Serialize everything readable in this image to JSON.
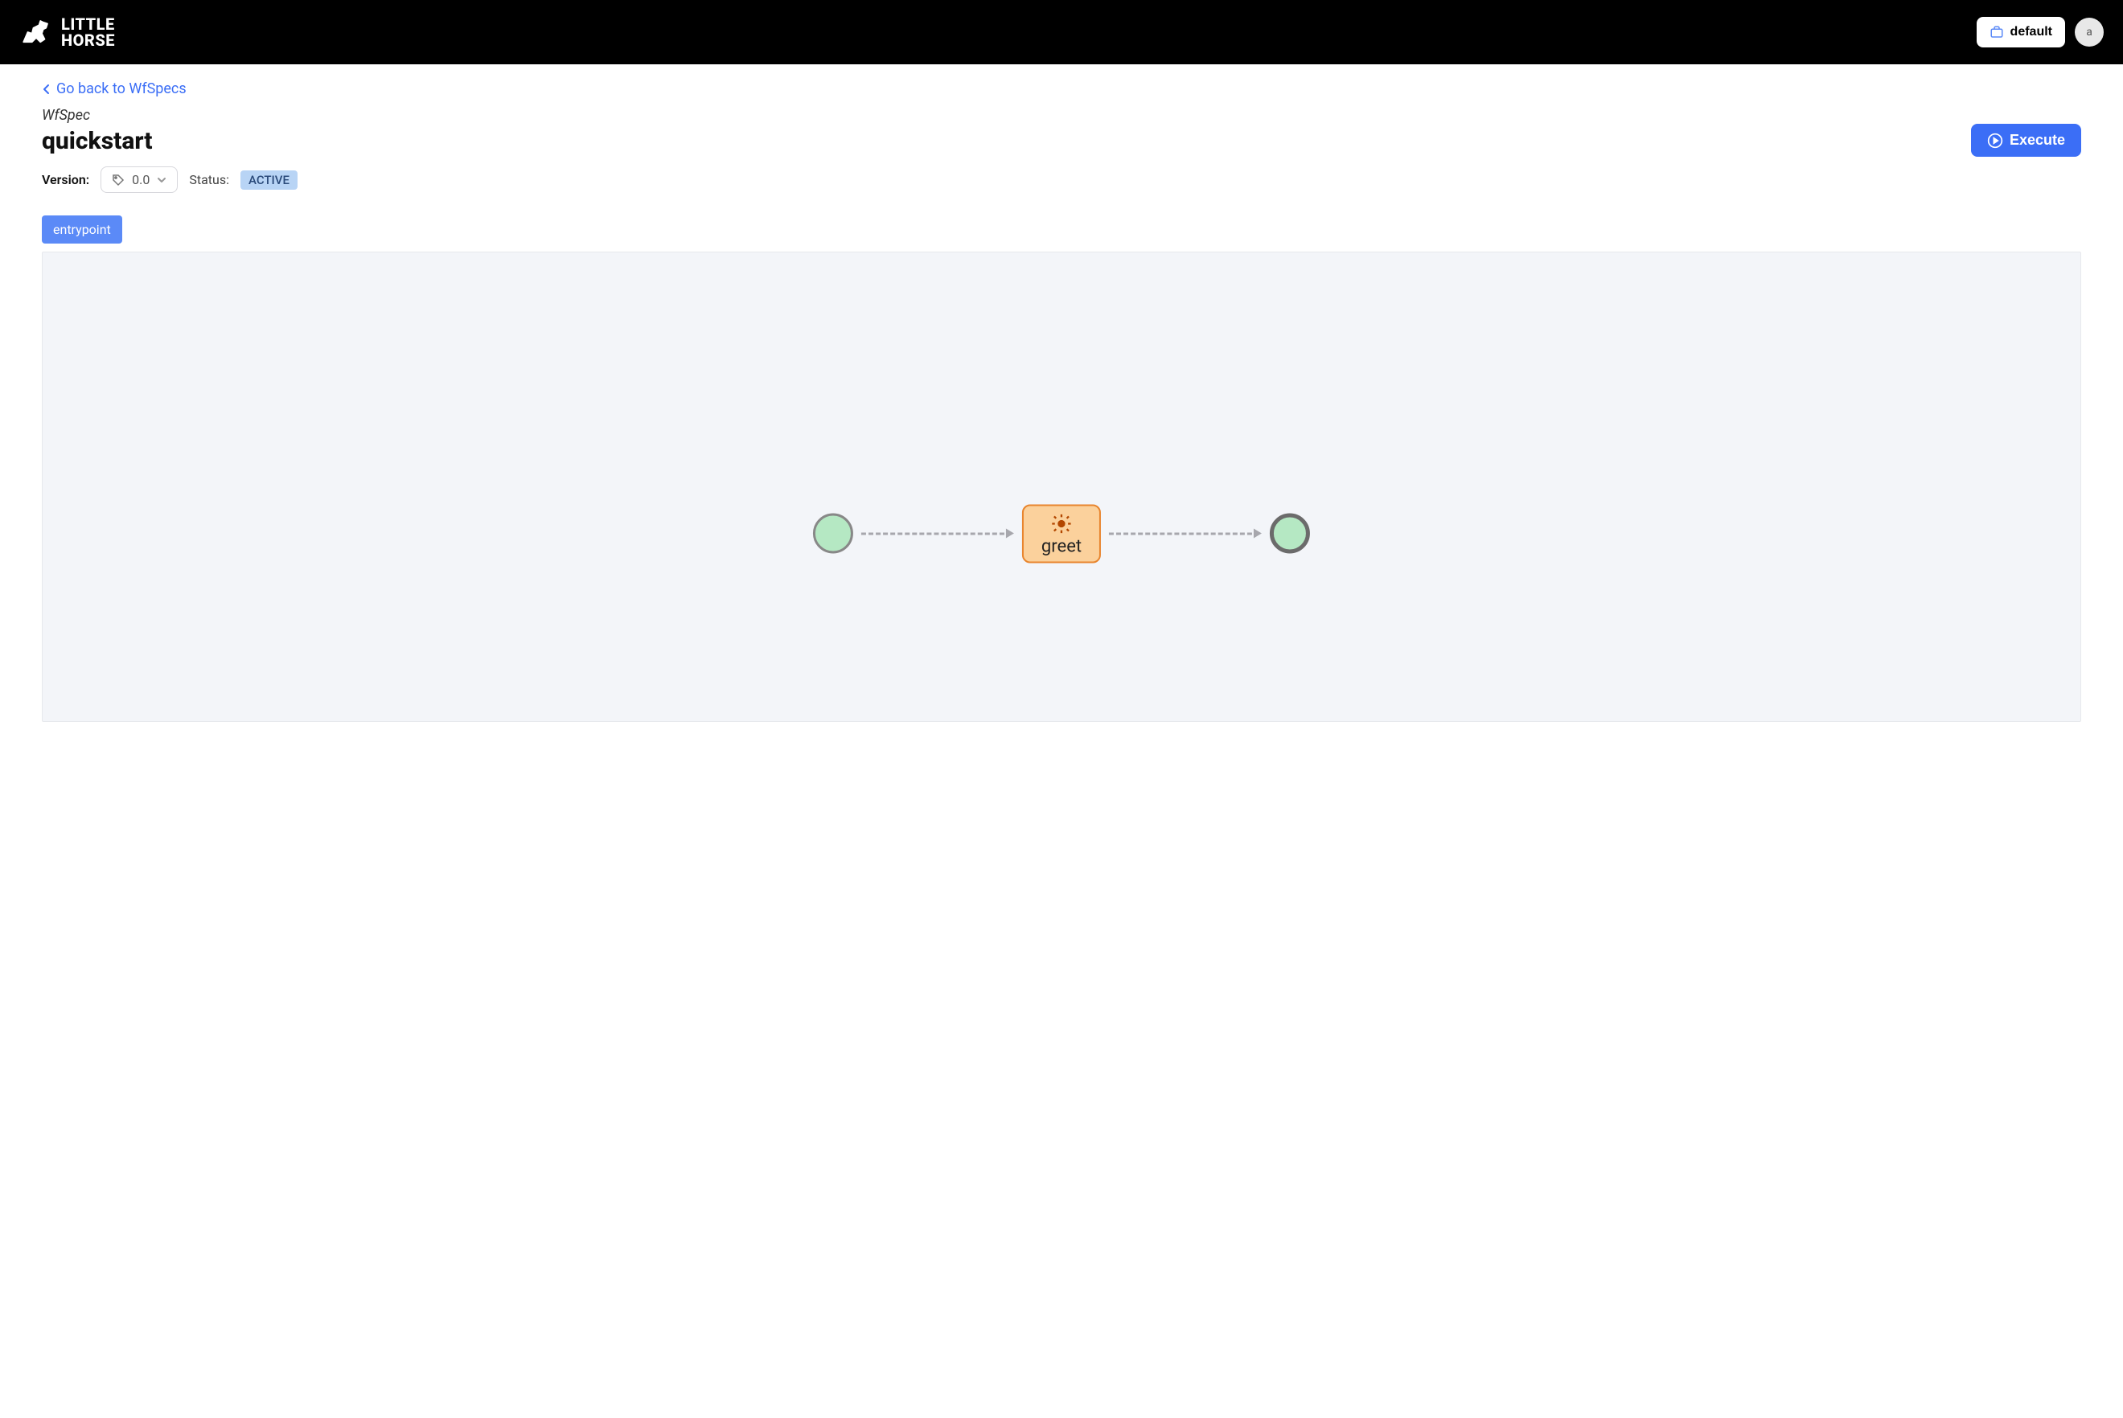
{
  "header": {
    "brand_line1": "LITTLE",
    "brand_line2": "HORSE",
    "tenant_label": "default",
    "avatar_initial": "a"
  },
  "nav": {
    "back_link": "Go back to WfSpecs"
  },
  "page": {
    "breadcrumb_label": "WfSpec",
    "title": "quickstart",
    "execute_label": "Execute",
    "version_label": "Version:",
    "version_value": "0.0",
    "status_label": "Status:",
    "status_value": "ACTIVE",
    "entrypoint_chip": "entrypoint"
  },
  "flow": {
    "task_label": "greet"
  }
}
